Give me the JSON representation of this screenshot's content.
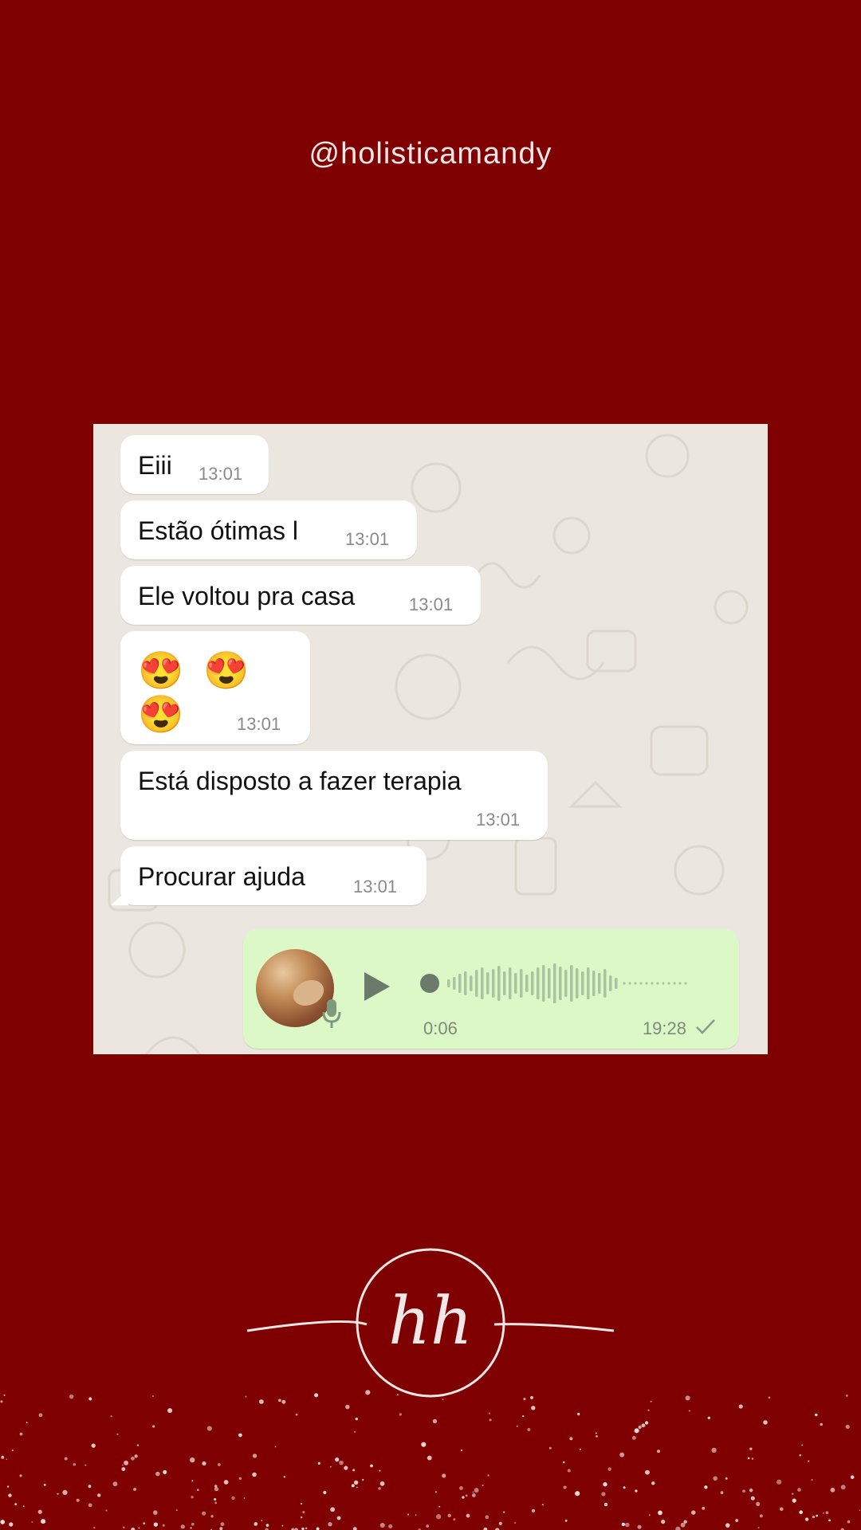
{
  "header": {
    "handle": "@holisticamandy"
  },
  "chat": {
    "messages": [
      {
        "text": "Eiii",
        "time": "13:01"
      },
      {
        "text": "Estão ótimas l",
        "time": "13:01"
      },
      {
        "text": "Ele voltou pra casa",
        "time": "13:01"
      },
      {
        "text": "😍 😍 😍",
        "time": "13:01"
      },
      {
        "text": "Está disposto a fazer terapia",
        "time": "13:01"
      },
      {
        "text": "Procurar ajuda",
        "time": "13:01"
      }
    ],
    "voice_note": {
      "duration": "0:06",
      "time": "19:28",
      "status_icon": "single-check-icon",
      "played": false
    }
  },
  "logo": {
    "letters": "hh"
  },
  "colors": {
    "background": "#7f0000",
    "chat_wallpaper": "#ebe6df",
    "incoming_bubble": "#ffffff",
    "outgoing_bubble": "#dcf8c6",
    "waveform": "#a9c4a0"
  }
}
